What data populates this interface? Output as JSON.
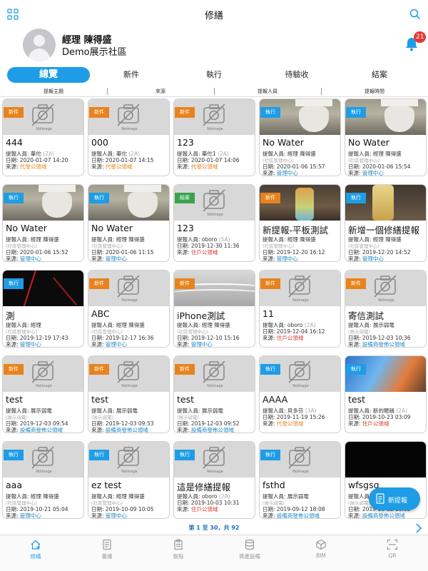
{
  "header": {
    "title": "修繕"
  },
  "profile": {
    "name": "經理 陳得盛",
    "community": "Demo展示社區",
    "notification_count": "21"
  },
  "tabs": [
    {
      "label": "總覽",
      "active": true
    },
    {
      "label": "新件",
      "active": false
    },
    {
      "label": "執行",
      "active": false
    },
    {
      "label": "待驗收",
      "active": false
    },
    {
      "label": "結案",
      "active": false
    }
  ],
  "columns": [
    "提報主題",
    "來源",
    "提報人員",
    "提報時間"
  ],
  "labels": {
    "reporter_prefix": "提報人員: ",
    "date_prefix": "日期: ",
    "source_prefix": "來源: ",
    "no_image": "NoImage"
  },
  "cards": [
    {
      "status": "新件",
      "kind": "new",
      "image": "none",
      "title": "444",
      "reporter": "華佗",
      "reporter_unit": "(2A)",
      "org": "",
      "date": "2020-01-07 14:20",
      "source": "代發公領域",
      "source_color": "orange"
    },
    {
      "status": "新件",
      "kind": "new",
      "image": "none",
      "title": "000",
      "reporter": "華佗",
      "reporter_unit": "(2A)",
      "org": "",
      "date": "2020-01-07 14:15",
      "source": "代發公領域",
      "source_color": "orange"
    },
    {
      "status": "新件",
      "kind": "new",
      "image": "none",
      "title": "123",
      "reporter": "華佗1",
      "reporter_unit": "(2A)",
      "org": "",
      "date": "2020-01-07 14:06",
      "source": "代發公領域",
      "source_color": "orange"
    },
    {
      "status": "執行",
      "kind": "exec",
      "image": "bathroom",
      "title": "No Water",
      "reporter": "經理 陳得盛",
      "reporter_unit": "",
      "org": "(社區管理中心)",
      "date": "2020-01-06 15:57",
      "source": "管理中心",
      "source_color": "blue"
    },
    {
      "status": "執行",
      "kind": "exec",
      "image": "bathroom",
      "title": "No Water",
      "reporter": "經理 陳得盛",
      "reporter_unit": "",
      "org": "(社區管理中心)",
      "date": "2020-01-06 15:54",
      "source": "管理中心",
      "source_color": "blue"
    },
    {
      "status": "執行",
      "kind": "exec",
      "image": "bathroom",
      "title": "No Water",
      "reporter": "經理 陳得盛",
      "reporter_unit": "",
      "org": "(社區管理中心)",
      "date": "2020-01-06 15:52",
      "source": "管理中心",
      "source_color": "blue"
    },
    {
      "status": "執行",
      "kind": "exec",
      "image": "bathroom",
      "title": "No Water",
      "reporter": "經理 陳得盛",
      "reporter_unit": "",
      "org": "(社區管理中心)",
      "date": "2020-01-06 11:15",
      "source": "管理中心",
      "source_color": "blue"
    },
    {
      "status": "結案",
      "kind": "done",
      "image": "none",
      "title": "123",
      "reporter": "oboro",
      "reporter_unit": "(5A)",
      "org": "",
      "date": "2019-12-30 11:36",
      "source": "住戶公領域",
      "source_color": "red"
    },
    {
      "status": "新件",
      "kind": "new",
      "image": "table",
      "title": "新提報-平板測試",
      "reporter": "經理 陳得盛",
      "reporter_unit": "",
      "org": "(社區管理中心)",
      "date": "2019-12-20 16:12",
      "source": "管理中心",
      "source_color": "blue"
    },
    {
      "status": "執行",
      "kind": "exec",
      "image": "bottle",
      "title": "新增一個修繕提報",
      "reporter": "經理 陳得盛",
      "reporter_unit": "",
      "org": "(社區管理中心)",
      "date": "2019-12-20 14:52",
      "source": "管理中心",
      "source_color": "blue"
    },
    {
      "status": "執行",
      "kind": "exec",
      "image": "dark",
      "title": "測",
      "reporter": "經理",
      "reporter_unit": "",
      "org": "(社區管理中心)",
      "date": "2019-12-19 17:43",
      "source": "管理中心",
      "source_color": "blue"
    },
    {
      "status": "新件",
      "kind": "new",
      "image": "none",
      "title": "ABC",
      "reporter": "經理 陳得盛",
      "reporter_unit": "",
      "org": "(社區管理中心)",
      "date": "2019-12-17 16:36",
      "source": "管理中心",
      "source_color": "blue"
    },
    {
      "status": "新件",
      "kind": "new",
      "image": "cable",
      "title": "iPhone測試",
      "reporter": "經理 陳得盛",
      "reporter_unit": "",
      "org": "(社區管理中心)",
      "date": "2019-12-10 15:16",
      "source": "管理中心",
      "source_color": "blue"
    },
    {
      "status": "新件",
      "kind": "new",
      "image": "none",
      "title": "11",
      "reporter": "oboro",
      "reporter_unit": "(2A)",
      "org": "",
      "date": "2019-12-04 16:12",
      "source": "住戶公領域",
      "source_color": "red"
    },
    {
      "status": "新件",
      "kind": "new",
      "image": "none",
      "title": "寄信測試",
      "reporter": "展示弱電",
      "reporter_unit": "",
      "org": "(展示弱電)",
      "date": "2019-12-03 10:36",
      "source": "設備商發佈公領域",
      "source_color": "blue"
    },
    {
      "status": "新件",
      "kind": "new",
      "image": "none",
      "title": "test",
      "reporter": "展示弱電",
      "reporter_unit": "",
      "org": "(展示弱電)",
      "date": "2019-12-03 09:54",
      "source": "設備商發佈公領域",
      "source_color": "blue"
    },
    {
      "status": "新件",
      "kind": "new",
      "image": "none",
      "title": "test",
      "reporter": "展示弱電",
      "reporter_unit": "",
      "org": "(展示弱電)",
      "date": "2019-12-03 09:53",
      "source": "設備商發佈公領域",
      "source_color": "blue"
    },
    {
      "status": "新件",
      "kind": "new",
      "image": "none",
      "title": "test",
      "reporter": "展示弱電",
      "reporter_unit": "",
      "org": "(展示弱電)",
      "date": "2019-12-03 09:52",
      "source": "設備商發佈公領域",
      "source_color": "blue"
    },
    {
      "status": "執行",
      "kind": "exec",
      "image": "none",
      "title": "AAAA",
      "reporter": "貝多芬",
      "reporter_unit": "(3A)",
      "org": "",
      "date": "2019-11-19 15:26",
      "source": "代發公領域",
      "source_color": "orange"
    },
    {
      "status": "執行",
      "kind": "exec",
      "image": "screen",
      "title": "test",
      "reporter": "新的暱稱",
      "reporter_unit": "(2A)",
      "org": "",
      "date": "2019-10-23 03:09",
      "source": "住戶公領域",
      "source_color": "red"
    },
    {
      "status": "執行",
      "kind": "exec",
      "image": "none",
      "title": "aaa",
      "reporter": "經理 陳得盛",
      "reporter_unit": "",
      "org": "(社區管理中心)",
      "date": "2019-10-21 05:04",
      "source": "管理中心",
      "source_color": "blue"
    },
    {
      "status": "執行",
      "kind": "exec",
      "image": "none",
      "title": "ez test",
      "reporter": "經理 陳得盛",
      "reporter_unit": "",
      "org": "(社區管理中心)",
      "date": "2019-10-09 10:05",
      "source": "管理中心",
      "source_color": "blue"
    },
    {
      "status": "執行",
      "kind": "exec",
      "image": "none",
      "title": "這是修繕提報",
      "reporter": "oboro",
      "reporter_unit": "(2A)",
      "org": "",
      "date": "2019-10-03 10:31",
      "source": "住戶公領域",
      "source_color": "red"
    },
    {
      "status": "執行",
      "kind": "exec",
      "image": "none",
      "title": "fsthd",
      "reporter": "展示弱電",
      "reporter_unit": "",
      "org": "(展示弱電)",
      "date": "2019-09-12 18:08",
      "source": "設備商發佈公領域",
      "source_color": "blue"
    },
    {
      "status": "",
      "kind": "",
      "image": "black",
      "title": "wfsgsg",
      "reporter": "",
      "reporter_unit": "",
      "org": "(展示弱電)",
      "date": "2019-09-12 18:05",
      "source": "設備商發佈公領域",
      "source_color": "blue"
    }
  ],
  "fab": {
    "label": "新提報"
  },
  "pagination": {
    "text": "第 1 至 30，共 92"
  },
  "bottom_nav": [
    {
      "label": "修繕",
      "icon": "home-icon",
      "active": true
    },
    {
      "label": "養護",
      "icon": "document-icon",
      "active": false
    },
    {
      "label": "盤點",
      "icon": "clipboard-icon",
      "active": false
    },
    {
      "label": "資產設備",
      "icon": "database-icon",
      "active": false
    },
    {
      "label": "BIM",
      "icon": "cube-icon",
      "active": false
    },
    {
      "label": "QR",
      "icon": "qr-icon",
      "active": false
    }
  ],
  "colors": {
    "accent": "#1e9de6",
    "new_tag": "#e8831c",
    "exec_tag": "#1e9de6",
    "done_tag": "#3aa34f",
    "badge": "#e53935"
  }
}
